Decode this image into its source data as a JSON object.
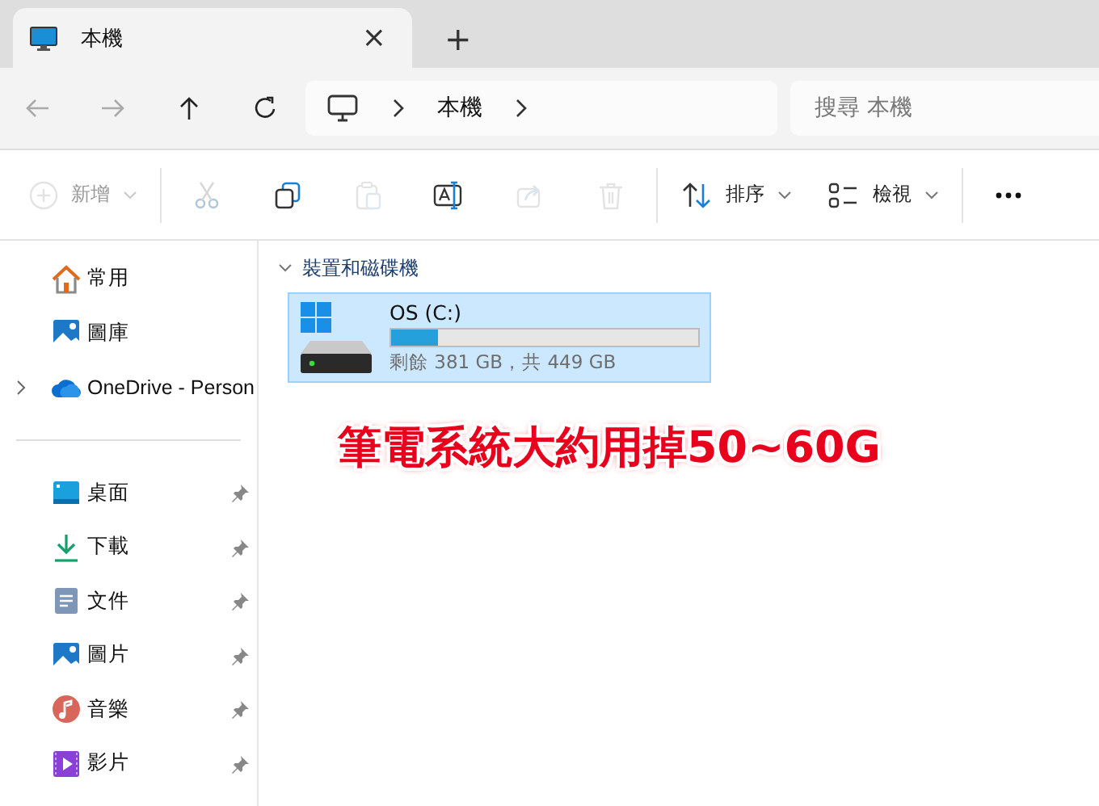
{
  "tabs": [
    {
      "label": "本機",
      "selected": true,
      "close_button": "×"
    }
  ],
  "new_tab_button": "+",
  "nav_buttons": [
    {
      "kind": "back",
      "disabled": true
    },
    {
      "kind": "forward",
      "disabled": true
    },
    {
      "kind": "up",
      "disabled": false
    },
    {
      "kind": "refresh",
      "disabled": false
    }
  ],
  "address": {
    "crumbs": [
      "本機"
    ]
  },
  "search": {
    "placeholder": "搜尋 本機"
  },
  "toolbar": {
    "groups": [
      [
        {
          "kind": "new",
          "label": "新增",
          "disabled": true
        }
      ],
      [
        {
          "kind": "cut",
          "disabled": true
        },
        {
          "kind": "copy",
          "disabled": false
        },
        {
          "kind": "paste",
          "disabled": true
        },
        {
          "kind": "rename",
          "disabled": false
        },
        {
          "kind": "share",
          "disabled": true
        },
        {
          "kind": "delete",
          "disabled": true
        }
      ],
      [
        {
          "kind": "sort",
          "label": "排序",
          "disabled": false
        },
        {
          "kind": "view",
          "label": "檢視",
          "disabled": false
        }
      ],
      [
        {
          "kind": "more",
          "disabled": false
        }
      ]
    ]
  },
  "sidebar": {
    "sections": [
      [
        {
          "kind": "home",
          "label": "常用",
          "pinned": false
        },
        {
          "kind": "gallery",
          "label": "圖庫",
          "pinned": false
        },
        {
          "kind": "onedrive",
          "label": "OneDrive - Person",
          "pinned": false,
          "expanded": false
        }
      ],
      [
        {
          "kind": "desktop",
          "label": "桌面",
          "pinned": true
        },
        {
          "kind": "downloads",
          "label": "下載",
          "pinned": true
        },
        {
          "kind": "documents",
          "label": "文件",
          "pinned": true
        },
        {
          "kind": "pictures",
          "label": "圖片",
          "pinned": true
        },
        {
          "kind": "music",
          "label": "音樂",
          "pinned": true
        },
        {
          "kind": "videos",
          "label": "影片",
          "pinned": true
        }
      ]
    ]
  },
  "content": {
    "group": {
      "label": "裝置和磁碟機",
      "expanded": true,
      "drives": [
        {
          "name": "OS (C:)",
          "level": 0.15,
          "space": "剩餘 381 GB，共 449 GB",
          "selected": true
        }
      ]
    }
  },
  "annotation": {
    "text": "筆電系統大約用掉50~60G"
  }
}
